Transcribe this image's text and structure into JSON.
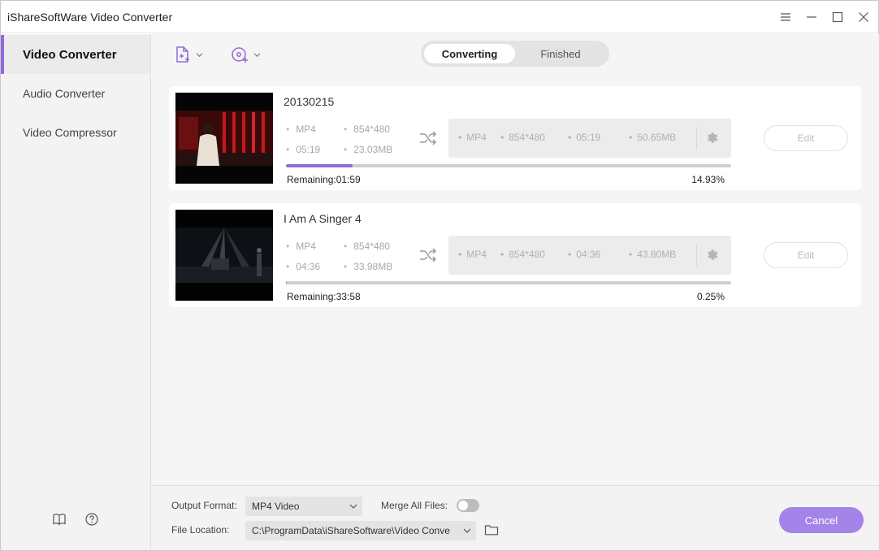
{
  "window": {
    "title": "iShareSoftWare Video Converter",
    "controls": [
      "menu-icon",
      "minimize-icon",
      "maximize-icon",
      "close-icon"
    ]
  },
  "sidebar": {
    "items": [
      {
        "label": "Video Converter",
        "active": true
      },
      {
        "label": "Audio Converter",
        "active": false
      },
      {
        "label": "Video Compressor",
        "active": false
      }
    ],
    "bottom_icons": [
      "book-icon",
      "help-icon"
    ]
  },
  "toolbar": {
    "add_file_icon": "add-file-icon",
    "add_disc_icon": "add-disc-icon"
  },
  "tabs": [
    {
      "label": "Converting",
      "active": true
    },
    {
      "label": "Finished",
      "active": false
    }
  ],
  "tasks": [
    {
      "title": "20130215",
      "source": {
        "format": "MP4",
        "resolution": "854*480",
        "duration": "05:19",
        "size": "23.03MB"
      },
      "target": {
        "format": "MP4",
        "resolution": "854*480",
        "duration": "05:19",
        "size": "50.65MB"
      },
      "edit_label": "Edit",
      "remaining": "Remaining:01:59",
      "percent": "14.93%",
      "progress": 0.1493
    },
    {
      "title": "I Am A Singer 4",
      "source": {
        "format": "MP4",
        "resolution": "854*480",
        "duration": "04:36",
        "size": "33.98MB"
      },
      "target": {
        "format": "MP4",
        "resolution": "854*480",
        "duration": "04:36",
        "size": "43.80MB"
      },
      "edit_label": "Edit",
      "remaining": "Remaining:33:58",
      "percent": "0.25%",
      "progress": 0.0025
    }
  ],
  "bottom": {
    "output_format_label": "Output Format:",
    "output_format_value": "MP4 Video",
    "merge_label": "Merge All Files:",
    "merge_enabled": false,
    "file_location_label": "File Location:",
    "file_location_value": "C:\\ProgramData\\iShareSoftware\\Video Conve",
    "cancel_label": "Cancel"
  },
  "colors": {
    "accent": "#8f6bdc",
    "cancel_button": "#a484e9",
    "sidebar_bg": "#f3f3f3",
    "main_bg": "#f5f5f5"
  }
}
